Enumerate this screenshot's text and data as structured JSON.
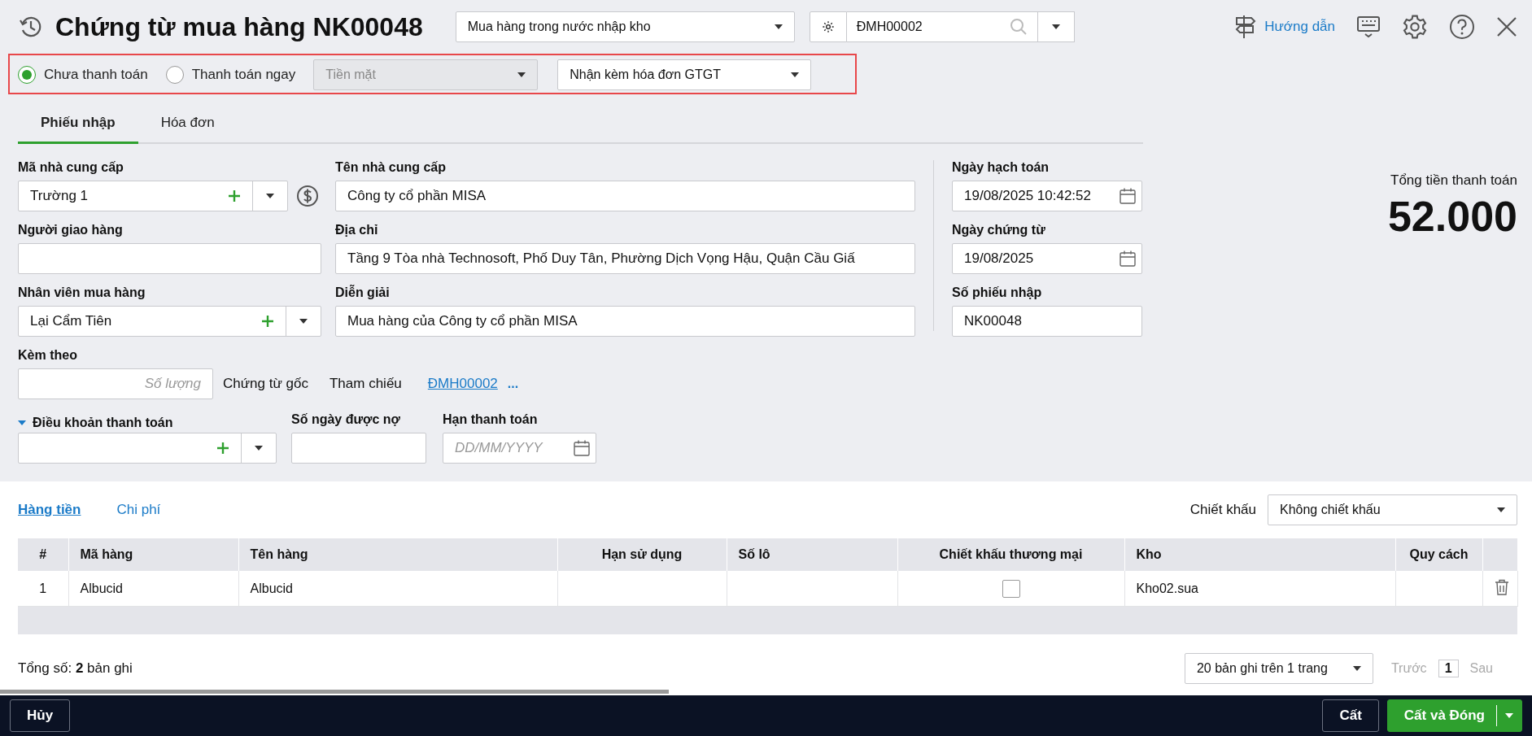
{
  "header": {
    "title": "Chứng từ mua hàng NK00048",
    "voucher_type": "Mua hàng trong nước nhập kho",
    "reference_search": "ĐMH00002",
    "help_link": "Hướng dẫn"
  },
  "payment_options": [
    {
      "label": "Chưa thanh toán",
      "selected": true
    },
    {
      "label": "Thanh toán ngay",
      "selected": false
    }
  ],
  "payment_method": {
    "value": "Tiền mặt",
    "disabled": true
  },
  "invoice_option": "Nhận kèm hóa đơn GTGT",
  "tabs": [
    {
      "label": "Phiếu nhập",
      "selected": true
    },
    {
      "label": "Hóa đơn",
      "selected": false
    }
  ],
  "form": {
    "supplier_code": {
      "label": "Mã nhà cung cấp",
      "value": "Trường 1"
    },
    "supplier_name": {
      "label": "Tên nhà cung cấp",
      "value": "Công ty cổ phần MISA"
    },
    "deliverer": {
      "label": "Người giao hàng"
    },
    "address": {
      "label": "Địa chỉ",
      "value": "Tầng 9 Tòa nhà Technosoft, Phố Duy Tân, Phường Dịch Vọng Hậu, Quận Cầu Giấ"
    },
    "purchaser": {
      "label": "Nhân viên mua hàng",
      "value": "Lại Cẩm Tiên"
    },
    "description": {
      "label": "Diễn giải",
      "value": "Mua hàng của Công ty cổ phần MISA"
    },
    "posting_date": {
      "label": "Ngày hạch toán",
      "value": "19/08/2025 10:42:52"
    },
    "voucher_date": {
      "label": "Ngày chứng từ",
      "value": "19/08/2025"
    },
    "receipt_no": {
      "label": "Số phiếu nhập",
      "value": "NK00048"
    },
    "attachments": {
      "label": "Kèm theo",
      "placeholder": "Số lượng",
      "suffix": "Chứng từ gốc"
    },
    "reference": {
      "label": "Tham chiếu",
      "link": "ĐMH00002",
      "more": "..."
    },
    "payment_terms": {
      "label": "Điều khoản thanh toán",
      "expanded": true
    },
    "credit_days": {
      "label": "Số ngày được nợ"
    },
    "due_date": {
      "label": "Hạn thanh toán",
      "placeholder": "DD/MM/YYYY"
    }
  },
  "total": {
    "label": "Tổng tiền thanh toán",
    "value": "52.000"
  },
  "detail_tabs": [
    {
      "label": "Hàng tiền",
      "selected": true
    },
    {
      "label": "Chi phí",
      "selected": false
    }
  ],
  "discount": {
    "label": "Chiết khấu",
    "value": "Không chiết khấu"
  },
  "table": {
    "columns": [
      "#",
      "Mã hàng",
      "Tên hàng",
      "Hạn sử dụng",
      "Số lô",
      "Chiết khấu thương mại",
      "Kho",
      "Quy cách"
    ],
    "rows": [
      {
        "index": "1",
        "item_code": "Albucid",
        "item_name": "Albucid",
        "trade_discount": false,
        "warehouse": "Kho02.sua"
      }
    ]
  },
  "footer": {
    "total_records": "Tổng số: **2** bản ghi",
    "page_size": "20 bản ghi trên 1 trang",
    "previous": {
      "label": "Trước",
      "disabled": true
    },
    "page": "1",
    "next": {
      "label": "Sau",
      "disabled": true
    }
  },
  "actions": {
    "cancel": "Hủy",
    "save": "Cất",
    "save_close": "Cất và Đóng"
  }
}
